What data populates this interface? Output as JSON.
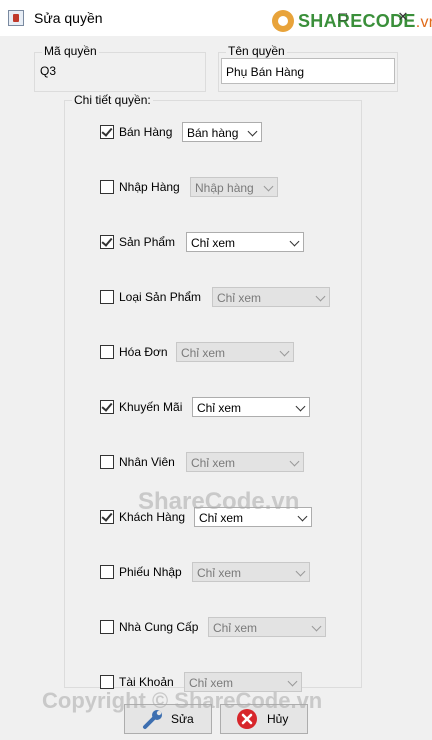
{
  "window": {
    "title": "Sửa quyền"
  },
  "logo": {
    "text_main": "SHARECODE",
    "text_suffix": ".vn"
  },
  "fields": {
    "ma_quyen": {
      "label": "Mã quyền",
      "value": "Q3"
    },
    "ten_quyen": {
      "label": "Tên quyền",
      "value": "Phụ Bán Hàng"
    }
  },
  "panel": {
    "title": "Chi tiết quyền:"
  },
  "permissions": [
    {
      "label": "Bán Hàng",
      "checked": true,
      "value": "Bán hàng",
      "enabled": true
    },
    {
      "label": "Nhập Hàng",
      "checked": false,
      "value": "Nhập hàng",
      "enabled": false
    },
    {
      "label": "Sản Phẩm",
      "checked": true,
      "value": "Chỉ xem",
      "enabled": true
    },
    {
      "label": "Loại Sản Phẩm",
      "checked": false,
      "value": "Chỉ xem",
      "enabled": false
    },
    {
      "label": "Hóa Đơn",
      "checked": false,
      "value": "Chỉ xem",
      "enabled": false
    },
    {
      "label": "Khuyến Mãi",
      "checked": true,
      "value": "Chỉ xem",
      "enabled": true
    },
    {
      "label": "Nhân Viên",
      "checked": false,
      "value": "Chỉ xem",
      "enabled": false
    },
    {
      "label": "Khách Hàng",
      "checked": true,
      "value": "Chỉ xem",
      "enabled": true
    },
    {
      "label": "Phiếu Nhập",
      "checked": false,
      "value": "Chỉ xem",
      "enabled": false
    },
    {
      "label": "Nhà Cung Cấp",
      "checked": false,
      "value": "Chỉ xem",
      "enabled": false
    },
    {
      "label": "Tài Khoản",
      "checked": false,
      "value": "Chỉ xem",
      "enabled": false
    }
  ],
  "buttons": {
    "save": "Sửa",
    "cancel": "Hủy"
  },
  "watermarks": {
    "center": "ShareCode.vn",
    "bottom": "Copyright © ShareCode.vn"
  }
}
